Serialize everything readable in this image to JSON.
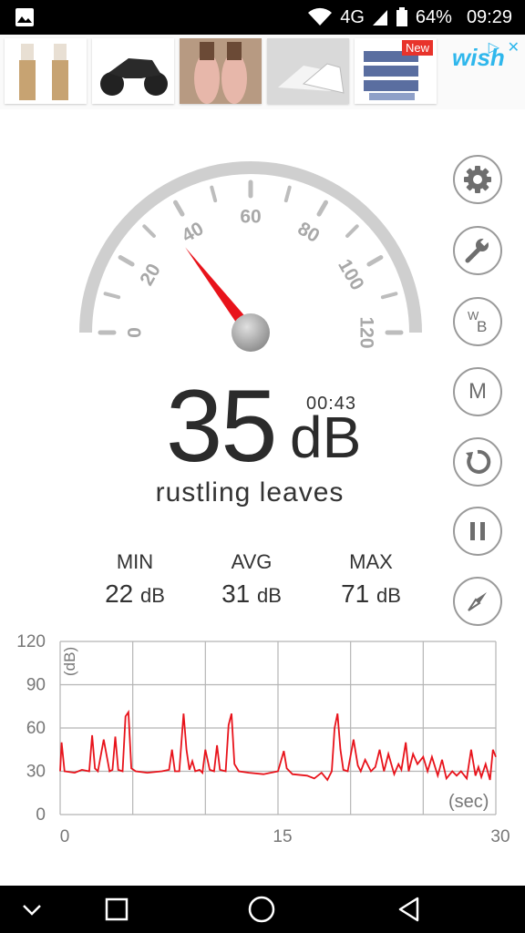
{
  "status_bar": {
    "network": "4G",
    "battery": "64%",
    "time": "09:29"
  },
  "ad": {
    "brand": "wish",
    "badge": "New",
    "close": "✕",
    "choices": "▷",
    "products": [
      "pants",
      "motorcycle",
      "dress",
      "sandals",
      "power-banks"
    ]
  },
  "gauge": {
    "ticks": [
      "0",
      "20",
      "40",
      "60",
      "80",
      "100",
      "120"
    ],
    "needle_value": 35,
    "max": 120
  },
  "reading": {
    "value": "35",
    "unit": "dB",
    "timer": "00:43",
    "description": "rustling leaves"
  },
  "stats": {
    "min": {
      "label": "MIN",
      "value": "22",
      "unit": "dB"
    },
    "avg": {
      "label": "AVG",
      "value": "31",
      "unit": "dB"
    },
    "max": {
      "label": "MAX",
      "value": "71",
      "unit": "dB"
    }
  },
  "side_buttons": [
    "gear-icon",
    "wrench-icon",
    "wb-icon",
    "m-icon",
    "reset-icon",
    "pause-icon",
    "compass-icon"
  ],
  "side_labels": {
    "wb_w": "W",
    "wb_b": "B",
    "m": "M"
  },
  "chart_data": {
    "type": "line",
    "ylabel": "(dB)",
    "xlabel": "(sec)",
    "ylim": [
      0,
      120
    ],
    "xlim": [
      0,
      30
    ],
    "y_ticks": [
      "120",
      "90",
      "60",
      "30",
      "0"
    ],
    "x_ticks": [
      "0",
      "15",
      "30"
    ],
    "series": [
      {
        "color": "#e8131b",
        "x": [
          0,
          0.1,
          0.3,
          1,
          1.5,
          2,
          2.2,
          2.4,
          2.6,
          3,
          3.4,
          3.6,
          3.8,
          4,
          4.3,
          4.5,
          4.7,
          4.9,
          5.2,
          6,
          7,
          7.5,
          7.7,
          7.9,
          8.2,
          8.5,
          8.7,
          8.9,
          9.1,
          9.3,
          9.6,
          9.8,
          10,
          10.3,
          10.6,
          10.8,
          11,
          11.4,
          11.6,
          11.8,
          12,
          12.3,
          13,
          14,
          15,
          15.4,
          15.6,
          16,
          17,
          17.5,
          18,
          18.4,
          18.7,
          18.9,
          19.1,
          19.3,
          19.5,
          19.8,
          20.2,
          20.5,
          20.7,
          21,
          21.4,
          21.7,
          22,
          22.3,
          22.6,
          23,
          23.3,
          23.5,
          23.8,
          24,
          24.3,
          24.6,
          25,
          25.3,
          25.6,
          26,
          26.3,
          26.6,
          27,
          27.3,
          27.6,
          28,
          28.3,
          28.6,
          28.8,
          29,
          29.3,
          29.6,
          29.8,
          30
        ],
        "values": [
          30,
          50,
          30,
          29,
          31,
          30,
          55,
          32,
          30,
          52,
          30,
          31,
          54,
          31,
          30,
          68,
          71,
          32,
          30,
          29,
          30,
          31,
          45,
          30,
          30,
          70,
          45,
          31,
          37,
          30,
          31,
          29,
          45,
          31,
          30,
          48,
          31,
          30,
          62,
          70,
          35,
          30,
          29,
          28,
          30,
          44,
          32,
          28,
          27,
          25,
          29,
          24,
          30,
          60,
          70,
          45,
          31,
          30,
          52,
          34,
          30,
          38,
          30,
          33,
          45,
          30,
          42,
          28,
          35,
          31,
          50,
          30,
          42,
          35,
          40,
          30,
          40,
          27,
          38,
          25,
          30,
          27,
          30,
          25,
          45,
          27,
          33,
          26,
          35,
          24,
          45,
          40
        ]
      }
    ]
  }
}
